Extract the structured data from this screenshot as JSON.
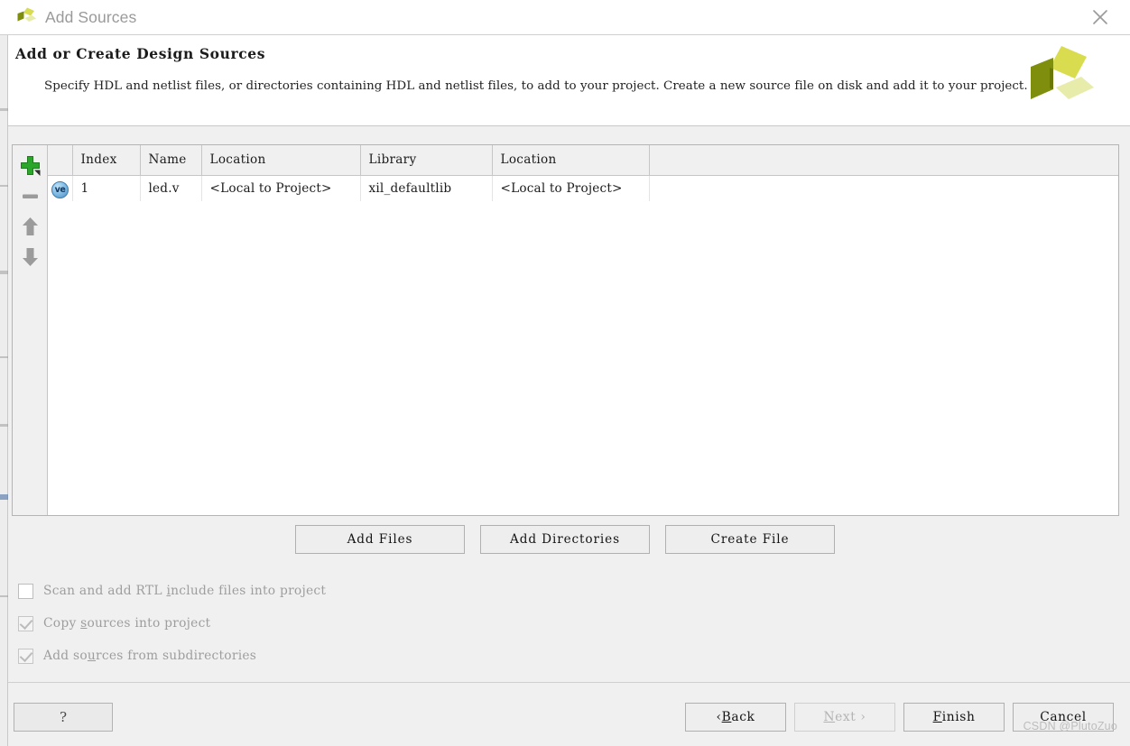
{
  "window": {
    "title": "Add Sources",
    "logo_icon": "xilinx-logo-icon",
    "close_icon": "close-icon"
  },
  "header": {
    "title": "Add or Create Design Sources",
    "description": "Specify HDL and netlist files, or directories containing HDL and netlist files, to add to your project. Create a new source file on disk and add it to your project.",
    "logo_icon": "xilinx-logo-icon"
  },
  "toolbar": {
    "add_icon": "plus-icon",
    "remove_icon": "minus-icon",
    "move_up_icon": "arrow-up-icon",
    "move_down_icon": "arrow-down-icon"
  },
  "table": {
    "columns": [
      "",
      "Index",
      "Name",
      "Location",
      "Library",
      "Location"
    ],
    "rows": [
      {
        "file_type_icon": "verilog-file-icon",
        "file_type_label": "ve",
        "index": "1",
        "name": "led.v",
        "location": "<Local to Project>",
        "library": "xil_defaultlib",
        "location2": "<Local to Project>"
      }
    ]
  },
  "actions": {
    "add_files": "Add Files",
    "add_directories": "Add Directories",
    "create_file": "Create File"
  },
  "options": [
    {
      "label_pre": "Scan and add RTL ",
      "label_mnemonic": "i",
      "label_post": "nclude files into project",
      "checked": false,
      "disabled": false
    },
    {
      "label_pre": "Copy ",
      "label_mnemonic": "s",
      "label_post": "ources into project",
      "checked": true,
      "disabled": true
    },
    {
      "label_pre": "Add so",
      "label_mnemonic": "u",
      "label_post": "rces from subdirectories",
      "checked": true,
      "disabled": true
    }
  ],
  "footer": {
    "help": "?",
    "back_pre": "‹ ",
    "back_mnemonic": "B",
    "back_post": "ack",
    "next_pre": "",
    "next_mnemonic": "N",
    "next_post": "ext ›",
    "next_disabled": true,
    "finish_mnemonic": "F",
    "finish_post": "inish",
    "cancel": "Cancel"
  },
  "watermark": "CSDN @PlutoZuo",
  "colors": {
    "logo_dark": "#7f8f0d",
    "logo_mid": "#d8dc4e",
    "logo_light": "#e8ecab",
    "window_bg": "#f0f0f0",
    "panel_bg": "#ffffff",
    "accent_green": "#28a428",
    "disabled_text": "#b3b3b3"
  }
}
